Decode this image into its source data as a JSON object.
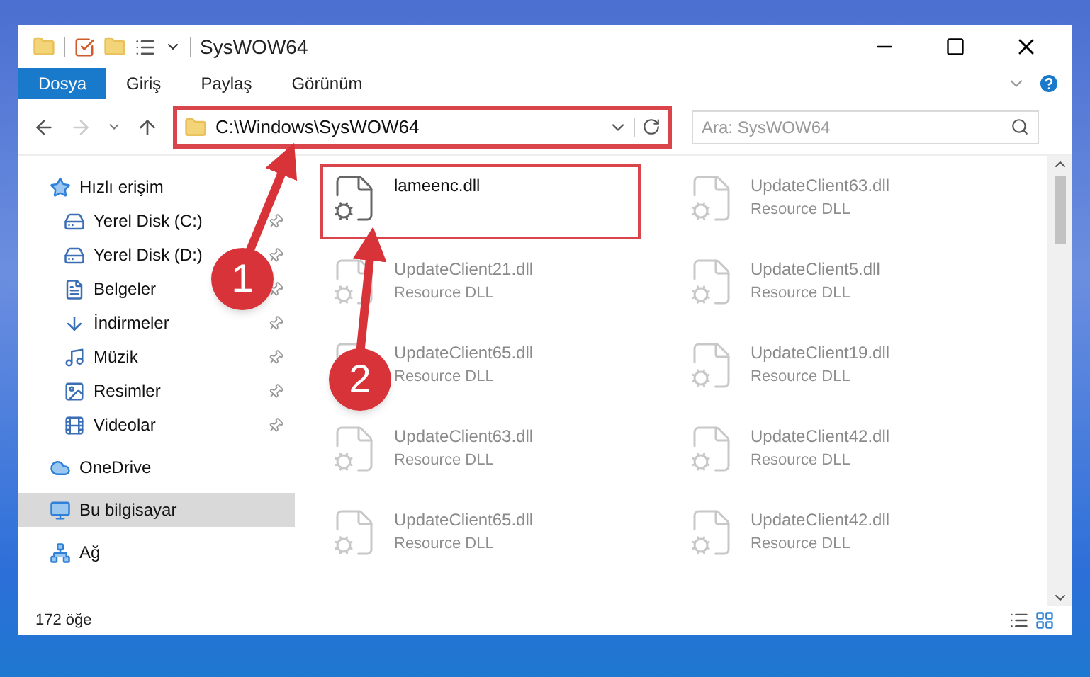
{
  "window": {
    "title": "SysWOW64"
  },
  "ribbon_tabs": [
    {
      "label": "Dosya",
      "selected": true
    },
    {
      "label": "Giriş",
      "selected": false
    },
    {
      "label": "Paylaş",
      "selected": false
    },
    {
      "label": "Görünüm",
      "selected": false
    }
  ],
  "address_bar": {
    "path": "C:\\Windows\\SysWOW64",
    "highlighted": true
  },
  "search": {
    "placeholder": "Ara: SysWOW64"
  },
  "sidebar": {
    "items": [
      {
        "label": "Hızlı erişim",
        "selected": false,
        "children": [
          {
            "label": "Yerel Disk (C:)",
            "pinned": true
          },
          {
            "label": "Yerel Disk (D:)",
            "pinned": true
          },
          {
            "label": "Belgeler",
            "pinned": true
          },
          {
            "label": "İndirmeler",
            "pinned": true
          },
          {
            "label": "Müzik",
            "pinned": true
          },
          {
            "label": "Resimler",
            "pinned": true
          },
          {
            "label": "Videolar",
            "pinned": true
          }
        ]
      },
      {
        "label": "OneDrive",
        "selected": false
      },
      {
        "label": "Bu bilgisayar",
        "selected": true
      },
      {
        "label": "Ağ",
        "selected": false
      }
    ]
  },
  "files": [
    {
      "name": "lameenc.dll",
      "dimmed": false,
      "highlighted": true
    },
    {
      "name": "UpdateClient63.dll",
      "type": "Resource DLL",
      "dimmed": true,
      "highlighted": false
    },
    {
      "name": "UpdateClient21.dll",
      "type": "Resource DLL",
      "dimmed": true,
      "highlighted": false
    },
    {
      "name": "UpdateClient5.dll",
      "type": "Resource DLL",
      "dimmed": true,
      "highlighted": false
    },
    {
      "name": "UpdateClient65.dll",
      "type": "Resource DLL",
      "dimmed": true,
      "highlighted": false
    },
    {
      "name": "UpdateClient19.dll",
      "type": "Resource DLL",
      "dimmed": true,
      "highlighted": false
    },
    {
      "name": "UpdateClient63.dll",
      "type": "Resource DLL",
      "dimmed": true,
      "highlighted": false
    },
    {
      "name": "UpdateClient42.dll",
      "type": "Resource DLL",
      "dimmed": true,
      "highlighted": false
    },
    {
      "name": "UpdateClient65.dll",
      "type": "Resource DLL",
      "dimmed": true,
      "highlighted": false
    },
    {
      "name": "UpdateClient42.dll",
      "type": "Resource DLL",
      "dimmed": true,
      "highlighted": false
    }
  ],
  "callouts": [
    {
      "number": "1"
    },
    {
      "number": "2"
    }
  ],
  "status_bar": {
    "count": "172 öğe"
  }
}
